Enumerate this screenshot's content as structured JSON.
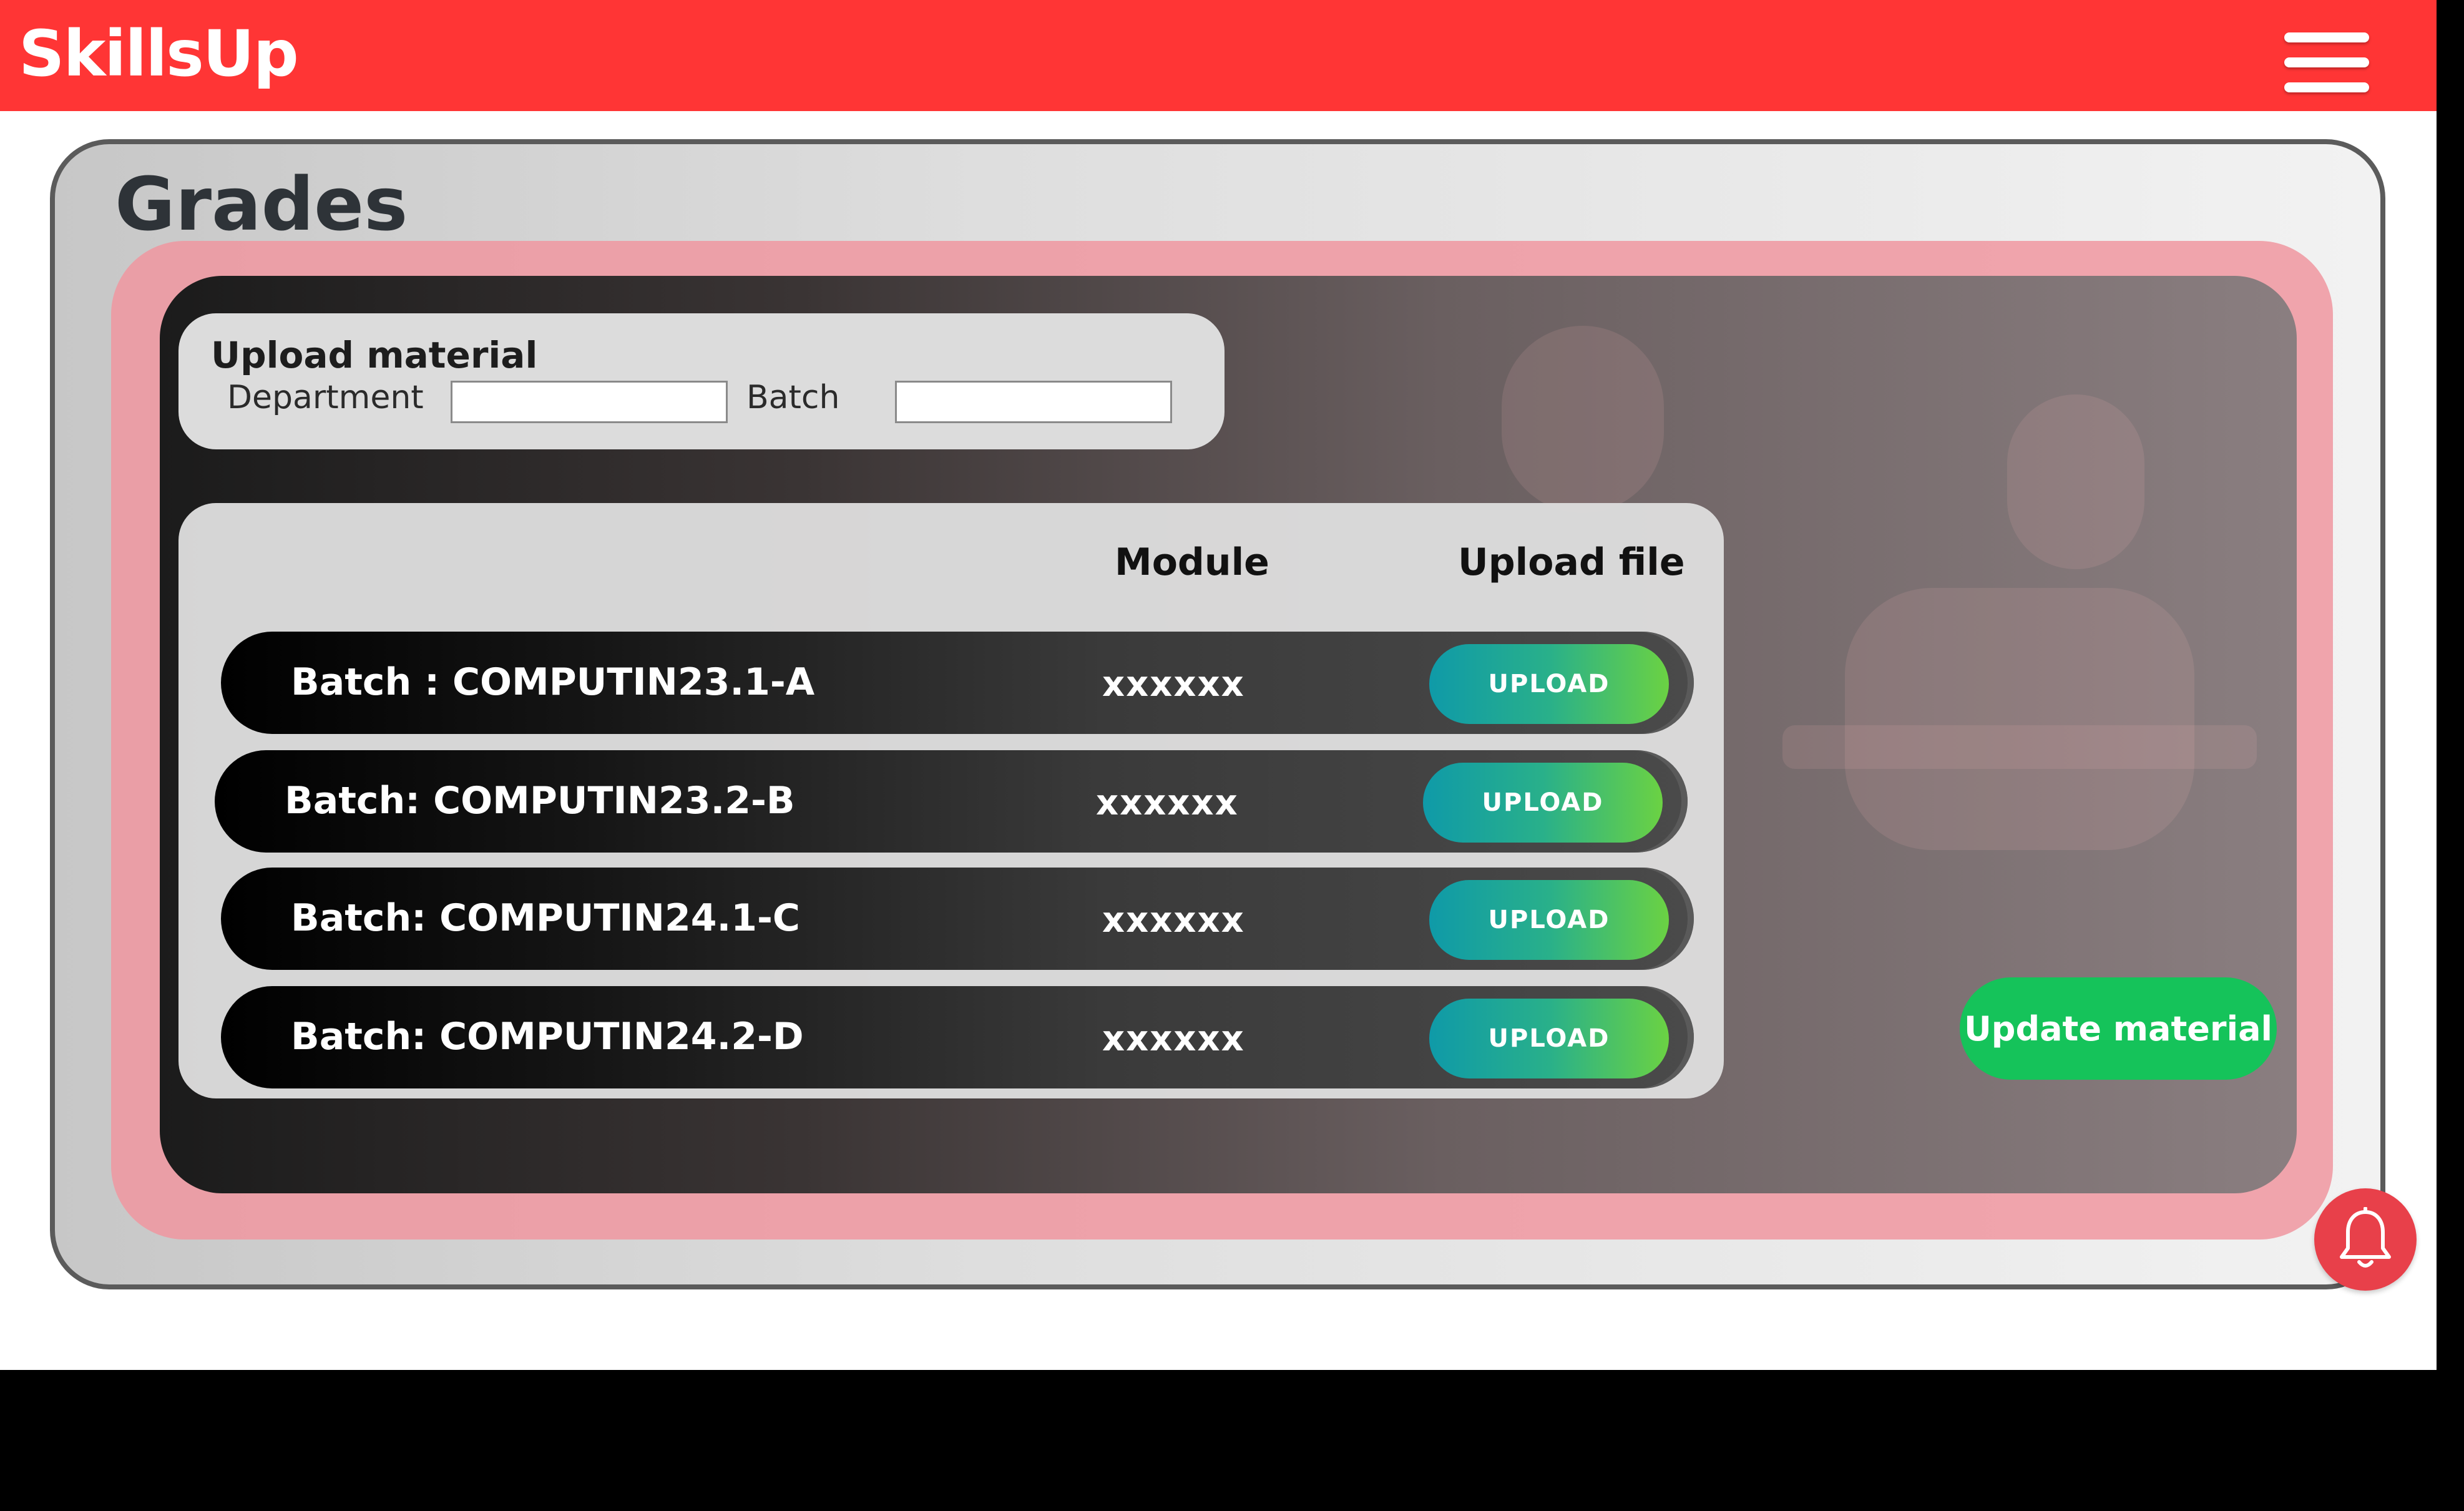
{
  "brand": {
    "name": "SkillsUp",
    "color": "#ff3535"
  },
  "page": {
    "title": "Grades"
  },
  "upload_card": {
    "title": "Upload material",
    "department_label": "Department",
    "department_value": "",
    "batch_label": "Batch",
    "batch_value": ""
  },
  "table": {
    "headers": {
      "module": "Module",
      "upload": "Upload file"
    },
    "rows": [
      {
        "batch": "Batch : COMPUTIN23.1-A",
        "module": "xxxxxx",
        "button": "UPLOAD"
      },
      {
        "batch": "Batch: COMPUTIN23.2-B",
        "module": "xxxxxx",
        "button": "UPLOAD"
      },
      {
        "batch": "Batch: COMPUTIN24.1-C",
        "module": "xxxxxx",
        "button": "UPLOAD"
      },
      {
        "batch": "Batch: COMPUTIN24.2-D",
        "module": "xxxxxx",
        "button": "UPLOAD"
      }
    ]
  },
  "actions": {
    "update_label": "Update material"
  },
  "icons": {
    "menu": "hamburger-menu-icon",
    "notification": "bell-icon"
  },
  "colors": {
    "accent_green": "#15c35a",
    "notification": "#e8404a"
  }
}
